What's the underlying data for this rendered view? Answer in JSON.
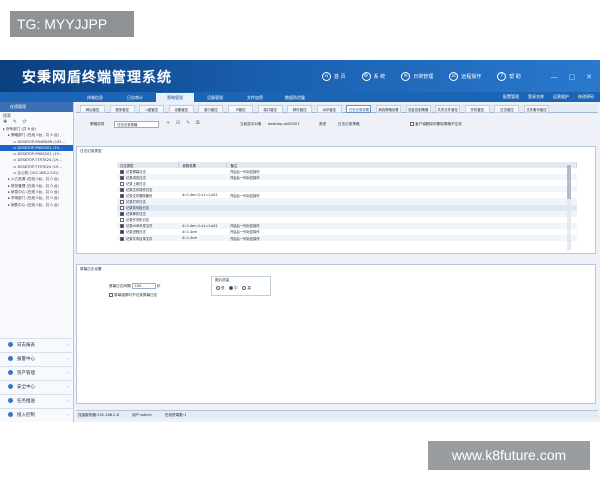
{
  "watermarks": {
    "top": "TG: MYYJJPP",
    "bottom": "www.k8future.com"
  },
  "app": {
    "title": "安秉网盾终端管理系统",
    "top_nav": [
      "首 页",
      "系 统",
      "日常管理",
      "远程操作",
      "帮 助"
    ],
    "window_controls": [
      "—",
      "▢",
      "✕"
    ],
    "menu_tabs": [
      "终端信息",
      "日志审计",
      "策略管理",
      "设备管理",
      "文件加密",
      "数据防泄露"
    ],
    "active_menu_tab": 2,
    "quick_links": [
      "配置管理",
      "登录名称",
      "运营维护",
      "修改密码"
    ]
  },
  "sidebar": {
    "header": "在线管理",
    "tools_label": "搜索",
    "tool_icons": "✚ ✎ ⟳",
    "tree": [
      {
        "label": "所有部门 (共 6 台)",
        "indent": 0,
        "selected": false
      },
      {
        "label": "策略部门 (在线 0台，共 5 台)",
        "indent": 1,
        "selected": false
      },
      {
        "label": "DESKTOP-R54BN58 (192...",
        "indent": 2,
        "selected": false
      },
      {
        "label": "DESKTOP-PH85301 (19...",
        "indent": 2,
        "selected": true
      },
      {
        "label": "DESKTOP-PH85201 (19...",
        "indent": 2,
        "selected": false
      },
      {
        "label": "DESKTOP-T7R7K24 (19...",
        "indent": 2,
        "selected": false
      },
      {
        "label": "DESKTOP-T7R7K24 (19...",
        "indent": 2,
        "selected": false
      },
      {
        "label": "办公机 (192.168.2.201)",
        "indent": 2,
        "selected": false
      },
      {
        "label": "人力资源 (在线 0台，共 0 台)",
        "indent": 1,
        "selected": false
      },
      {
        "label": "财务管理 (在线 0台，共 0 台)",
        "indent": 1,
        "selected": false
      },
      {
        "label": "研发中心 (在线 0台，共 0 台)",
        "indent": 1,
        "selected": false
      },
      {
        "label": "市场部门 (在线 0台，共 0 台)",
        "indent": 1,
        "selected": false
      },
      {
        "label": "销售中心 (在线 0台，共 0 台)",
        "indent": 1,
        "selected": false
      }
    ],
    "bottom_nav": [
      "日志报表",
      "报警中心",
      "资产管理",
      "安全中心",
      "任务推送",
      "接入控制"
    ]
  },
  "subtabs": {
    "items": [
      "网址管控",
      "程序管控",
      "U盘管控",
      "设备管控",
      "窗口管控",
      "IP管控",
      "端口管控",
      "邮件管控",
      "水印管控",
      "日志记录设置",
      "离线策略设置",
      "流量控制策略",
      "共享文件管控",
      "开机管控",
      "日志管控",
      "文件备份管控"
    ],
    "active_index": 9
  },
  "policy_row": {
    "strategy_label": "策略选择",
    "strategy_value": "日志记录策略",
    "toolbar_icons": [
      "+",
      "⊟",
      "✎",
      "⧉"
    ],
    "name_label": "当前选中对象",
    "name_value": "desktop-ph85301",
    "type_label": "类型",
    "type_value": "日志记录策略",
    "checkbox_label": "客户端删除时删除策略不生效"
  },
  "log_panel": {
    "title": "日志记录类型",
    "columns": [
      "日志类型",
      "参数设置",
      "备注"
    ],
    "rows": [
      {
        "checked": true,
        "type": "记录屏幕日志",
        "param": "",
        "note": "开启后一列对应操作"
      },
      {
        "checked": true,
        "type": "记录浏览日志",
        "param": "",
        "note": "开启后一列对应操作"
      },
      {
        "checked": false,
        "type": "记录上网日志",
        "param": "",
        "note": ""
      },
      {
        "checked": true,
        "type": "记录文件操作日志",
        "param": "",
        "note": ""
      },
      {
        "checked": true,
        "type": "记录文件删除备份",
        "param": "4=1.4m=1.u1=1.p01",
        "note": "开启后一列对应操作"
      },
      {
        "checked": false,
        "type": "记录打印日志",
        "param": "",
        "note": ""
      },
      {
        "checked": false,
        "type": "记录剪切板日志",
        "param": "",
        "note": ""
      },
      {
        "checked": true,
        "type": "记录邮件日志",
        "param": "",
        "note": ""
      },
      {
        "checked": false,
        "type": "记录开关机日志",
        "param": "",
        "note": ""
      },
      {
        "checked": true,
        "type": "记录USB外发文件",
        "param": "4=1.4m=1.u1=1.p01",
        "note": "开启后一列对应操作"
      },
      {
        "checked": true,
        "type": "记录进程日志",
        "param": "4=1.4cm",
        "note": "开启后一列对应操作"
      },
      {
        "checked": true,
        "type": "记录共享目录文件",
        "param": "4=1.4cm",
        "note": "开启后一列对应操作"
      }
    ]
  },
  "screen_panel": {
    "title": "屏幕日志设置",
    "interval_label": "屏幕日志间隔",
    "interval_value": "100",
    "interval_unit": "秒",
    "quality_title": "图片质量",
    "quality_options": [
      "低",
      "中",
      "高"
    ],
    "quality_selected": 1,
    "extra_option": "屏幕锁屏时不记录屏幕日志"
  },
  "status": {
    "server": "连接服务器:192.168.2.8",
    "user": "用户:admin",
    "online": "在线终端数:1"
  },
  "colors": {
    "title_bar": "#0b3f7e",
    "accent": "#1c65b5",
    "selected": "#1b66c9"
  }
}
